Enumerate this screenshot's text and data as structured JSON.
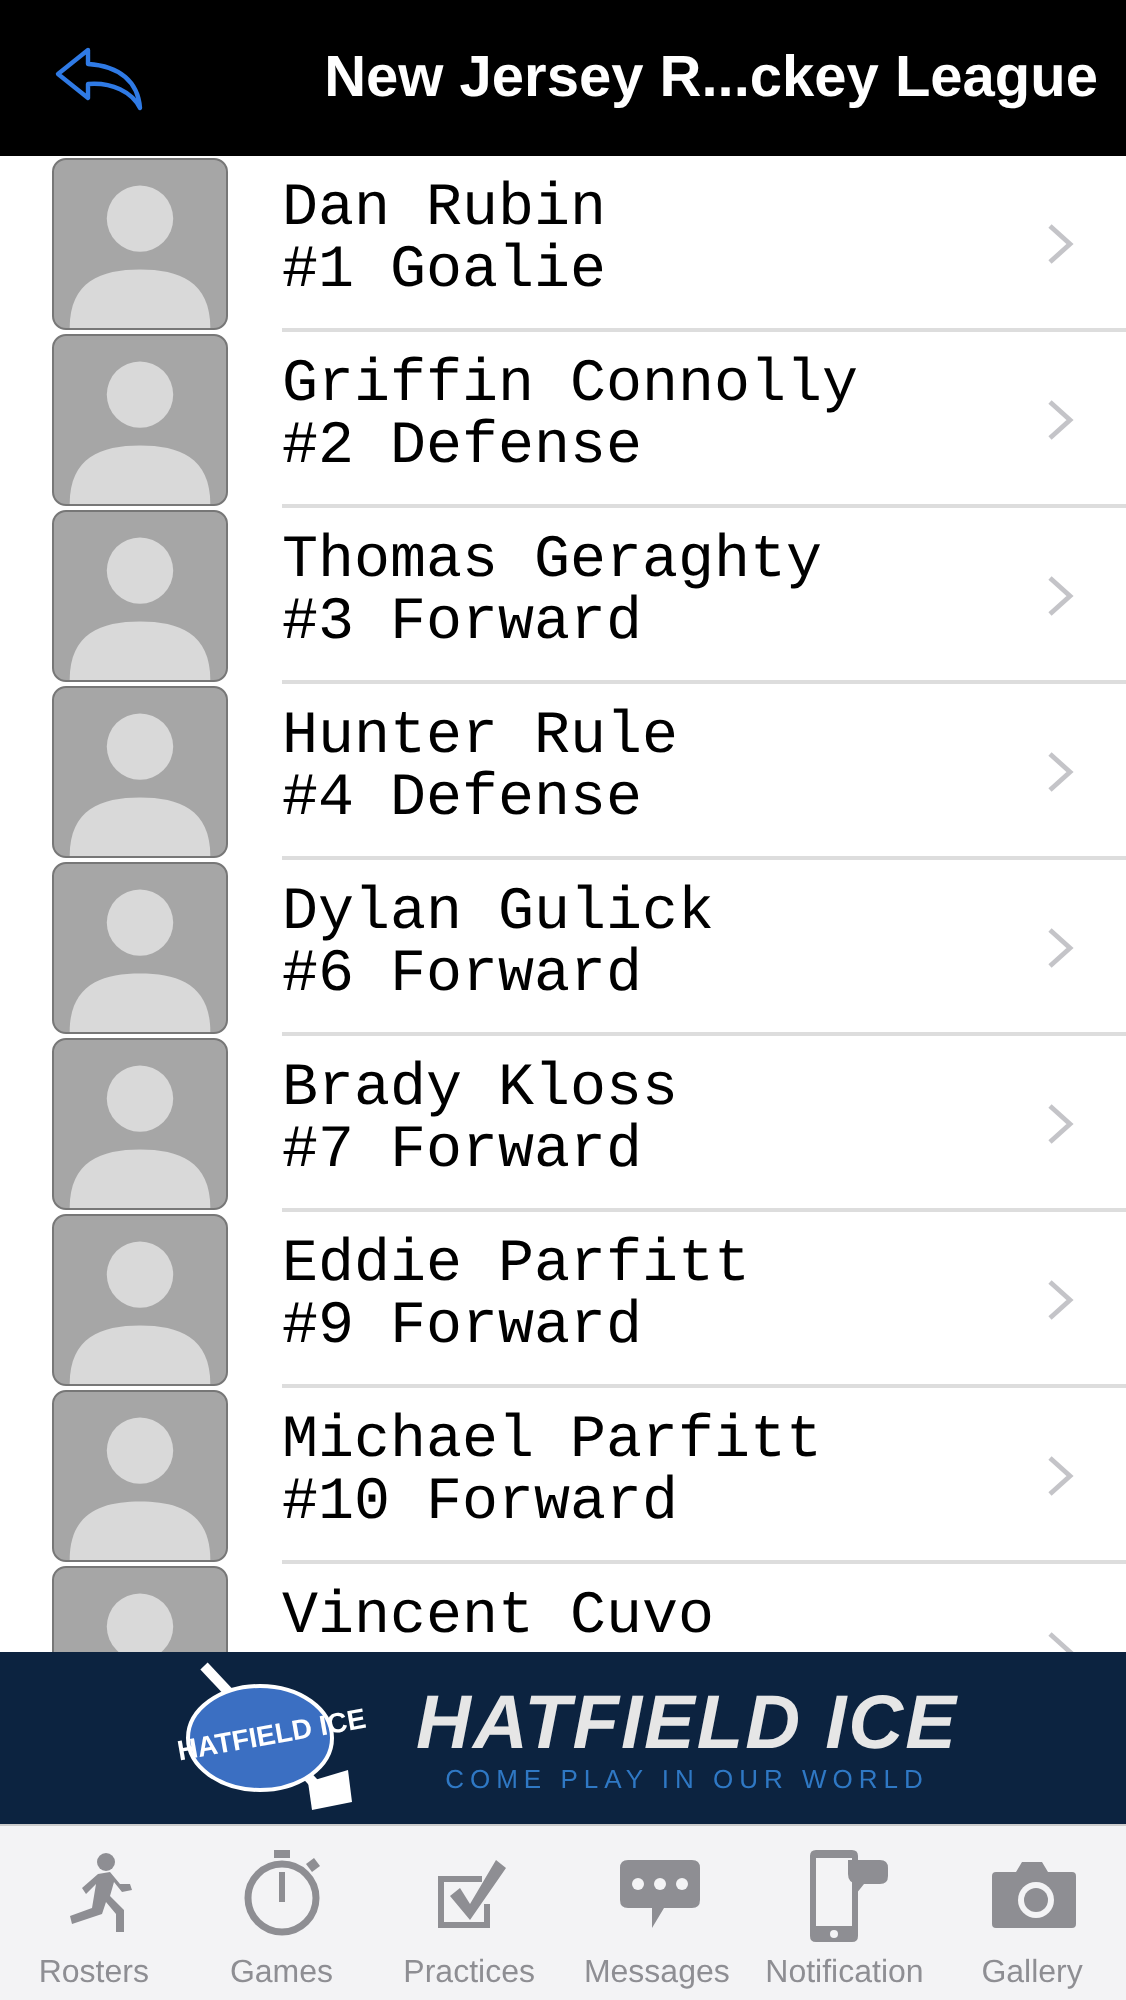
{
  "header": {
    "title": "New Jersey R...ckey League"
  },
  "players": [
    {
      "name": "Dan Rubin",
      "position": "#1 Goalie"
    },
    {
      "name": "Griffin Connolly",
      "position": "#2 Defense"
    },
    {
      "name": "Thomas Geraghty",
      "position": "#3 Forward"
    },
    {
      "name": "Hunter Rule",
      "position": "#4 Defense"
    },
    {
      "name": "Dylan Gulick",
      "position": "#6 Forward"
    },
    {
      "name": "Brady Kloss",
      "position": "#7 Forward"
    },
    {
      "name": "Eddie Parfitt",
      "position": "#9 Forward"
    },
    {
      "name": "Michael Parfitt",
      "position": "#10 Forward"
    },
    {
      "name": "Vincent Cuvo"
    }
  ],
  "banner": {
    "logo_text": "HATFIELD ICE",
    "title": "HATFIELD ICE",
    "tagline": "COME PLAY IN OUR WORLD"
  },
  "tabs": [
    {
      "label": "Rosters",
      "selected": false
    },
    {
      "label": "Games",
      "selected": false
    },
    {
      "label": "Practices",
      "selected": false
    },
    {
      "label": "Messages",
      "selected": false
    },
    {
      "label": "Notification",
      "selected": false
    },
    {
      "label": "Gallery",
      "selected": false
    }
  ]
}
